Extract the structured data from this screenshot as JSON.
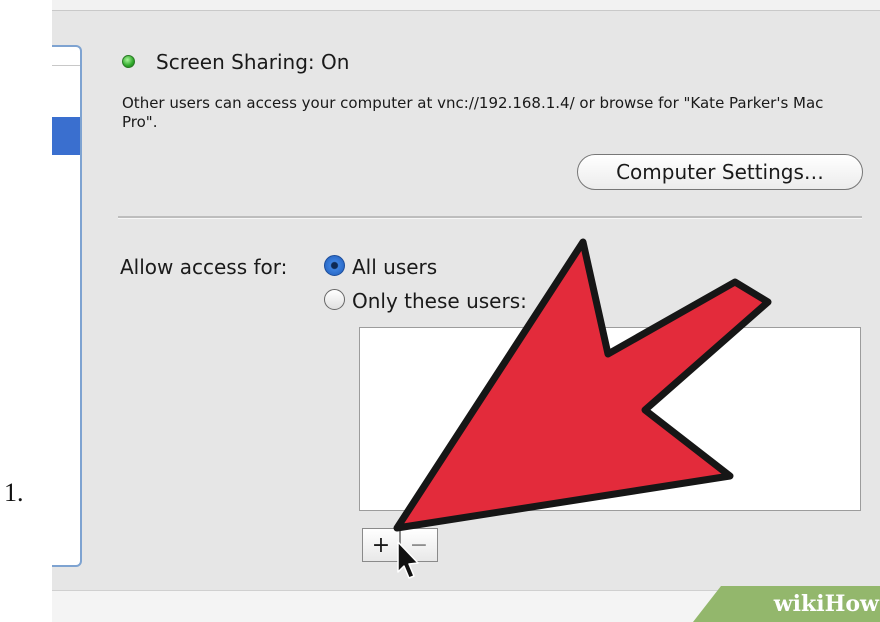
{
  "step": {
    "number": "1."
  },
  "sharing": {
    "status_title": "Screen Sharing: On",
    "status_color": "#2fa82a",
    "description": "Other users can access your computer at vnc://192.168.1.4/ or browse for \"Kate Parker's Mac Pro\".",
    "computer_settings_label": "Computer Settings…"
  },
  "access": {
    "label": "Allow access for:",
    "options": [
      {
        "label": "All users",
        "selected": true
      },
      {
        "label": "Only these users:",
        "selected": false
      }
    ],
    "add_label": "+",
    "remove_label": "−"
  },
  "watermark": {
    "text": "wikiHow"
  },
  "annotation": {
    "arrow_color": "#e32b3b",
    "icon": "pointer-arrow-icon"
  },
  "icons": [
    "status-dot-icon",
    "radio-selected-icon",
    "radio-unselected-icon",
    "cursor-icon"
  ]
}
